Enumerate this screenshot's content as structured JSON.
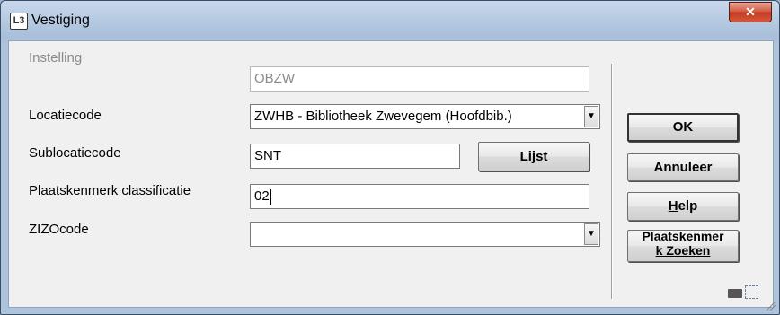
{
  "window": {
    "title": "Vestiging",
    "close_label": "✕"
  },
  "form": {
    "instelling": {
      "label": "Instelling",
      "value": "OBZW"
    },
    "locatiecode": {
      "label": "Locatiecode",
      "value": "ZWHB - Bibliotheek Zwevegem (Hoofdbib.)"
    },
    "sublocatiecode": {
      "label": "Sublocatiecode",
      "value": "SNT"
    },
    "plaatskenmerk": {
      "label": "Plaatskenmerk classificatie",
      "value": "02"
    },
    "zizocode": {
      "label": "ZIZOcode",
      "value": ""
    }
  },
  "buttons": {
    "lijst_pre": "L",
    "lijst_rest": "ijst",
    "ok": "OK",
    "annuleer": "Annuleer",
    "help_pre": "H",
    "help_rest": "elp",
    "zoeken_line1": "Plaatskenmer",
    "zoeken_line2": "k Zoeken"
  },
  "icons": {
    "app": "app-icon",
    "keyboard": "keyboard-icon",
    "expand": "expand-icon"
  }
}
